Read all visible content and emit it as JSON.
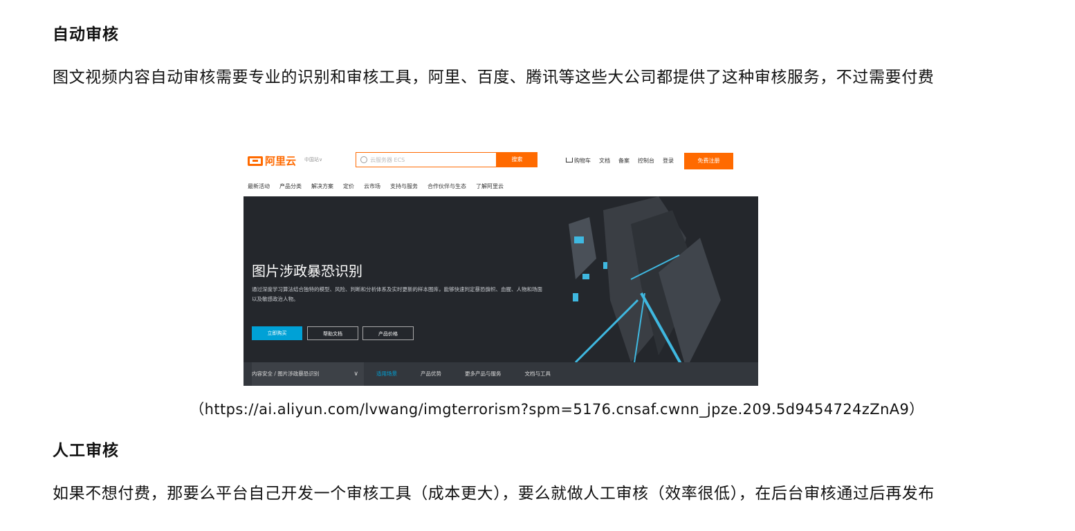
{
  "section1": {
    "heading": "自动审核",
    "text": "图文视频内容自动审核需要专业的识别和审核工具，阿里、百度、腾讯等这些大公司都提供了这种审核服务，不过需要付费"
  },
  "embedded_screenshot": {
    "logo_text": "阿里云",
    "region": "中国站∨",
    "search_placeholder": "云服务器 ECS",
    "search_button": "搜索",
    "top_links": [
      "购物车",
      "文档",
      "备案",
      "控制台",
      "登录"
    ],
    "register_button": "免费注册",
    "nav_items": [
      "最新活动",
      "产品分类",
      "解决方案",
      "定价",
      "云市场",
      "支持与服务",
      "合作伙伴与生态",
      "了解阿里云"
    ],
    "hero_title": "图片涉政暴恐识别",
    "hero_description": "通过深度学习算法结合独特的模型、风险、判断和分析体系及实时更新的样本图库，能够快速判定暴恐旗帜、血腥、人物和场面以及敏感政治人物。",
    "buttons": [
      "立即购买",
      "帮助文档",
      "产品价格"
    ],
    "breadcrumb": "内容安全 / 图片涉政暴恐识别",
    "breadcrumb_chevron": "∨",
    "sub_tabs": [
      "适用场景",
      "产品优势",
      "更多产品与服务",
      "文档与工具"
    ],
    "colors": {
      "brand": "#ff6a00",
      "accent": "#00a1d6",
      "hero_bg": "#24272c"
    }
  },
  "caption": "（https://ai.aliyun.com/lvwang/imgterrorism?spm=5176.cnsaf.cwnn_jpze.209.5d9454724zZnA9）",
  "section2": {
    "heading": "人工审核",
    "text": "如果不想付费，那要么平台自己开发一个审核工具（成本更大），要么就做人工审核（效率很低），在后台审核通过后再发布"
  }
}
